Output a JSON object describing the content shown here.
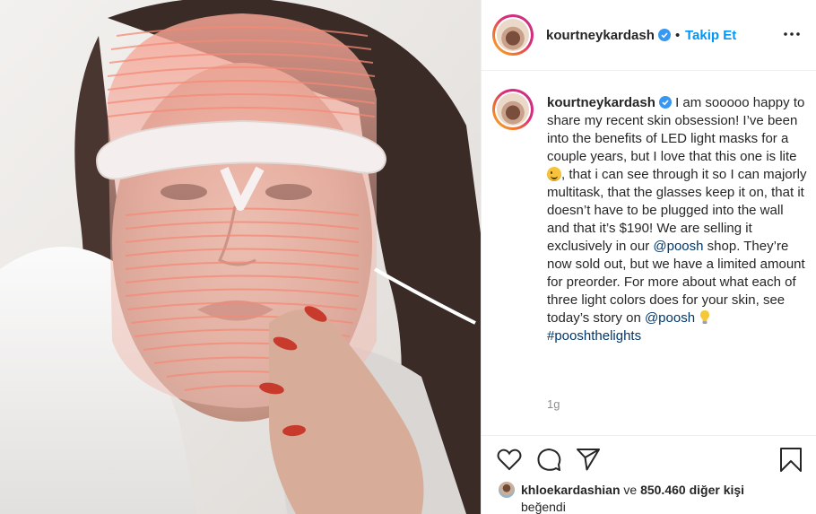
{
  "post": {
    "username": "kourtneykardash",
    "separator": "•",
    "follow_label": "Takip Et",
    "more_icon": "ellipsis-icon",
    "verified_icon": "verified-badge-icon",
    "caption": {
      "username": "kourtneykardash",
      "part1": "I am sooooo happy to share my recent skin obsession! I’ve been into the benefits of LED light masks for a couple years, but I love that this one is lite",
      "part2": ", that i can see through it so I can majorly multitask, that the glasses keep it on, that it doesn’t have to be plugged into the wall and that it’s $190! We are selling it exclusively in our",
      "mention1": "@poosh",
      "part3": "shop. They’re now sold out, but we have a limited amount for preorder. For more about what each of three light colors does for your skin, see today’s story on",
      "mention2": "@poosh",
      "hashtag": "#pooshthelights",
      "emojis": [
        "smiling-face-emoji",
        "light-bulb-emoji"
      ]
    },
    "timestamp": "1g",
    "action_icons": [
      "heart-icon",
      "comment-icon",
      "share-icon",
      "bookmark-icon"
    ],
    "likes": {
      "liked_by": "khloekardashian",
      "connector": "ve",
      "count_text": "850.460 diğer kişi",
      "suffix": "beğendi"
    }
  }
}
